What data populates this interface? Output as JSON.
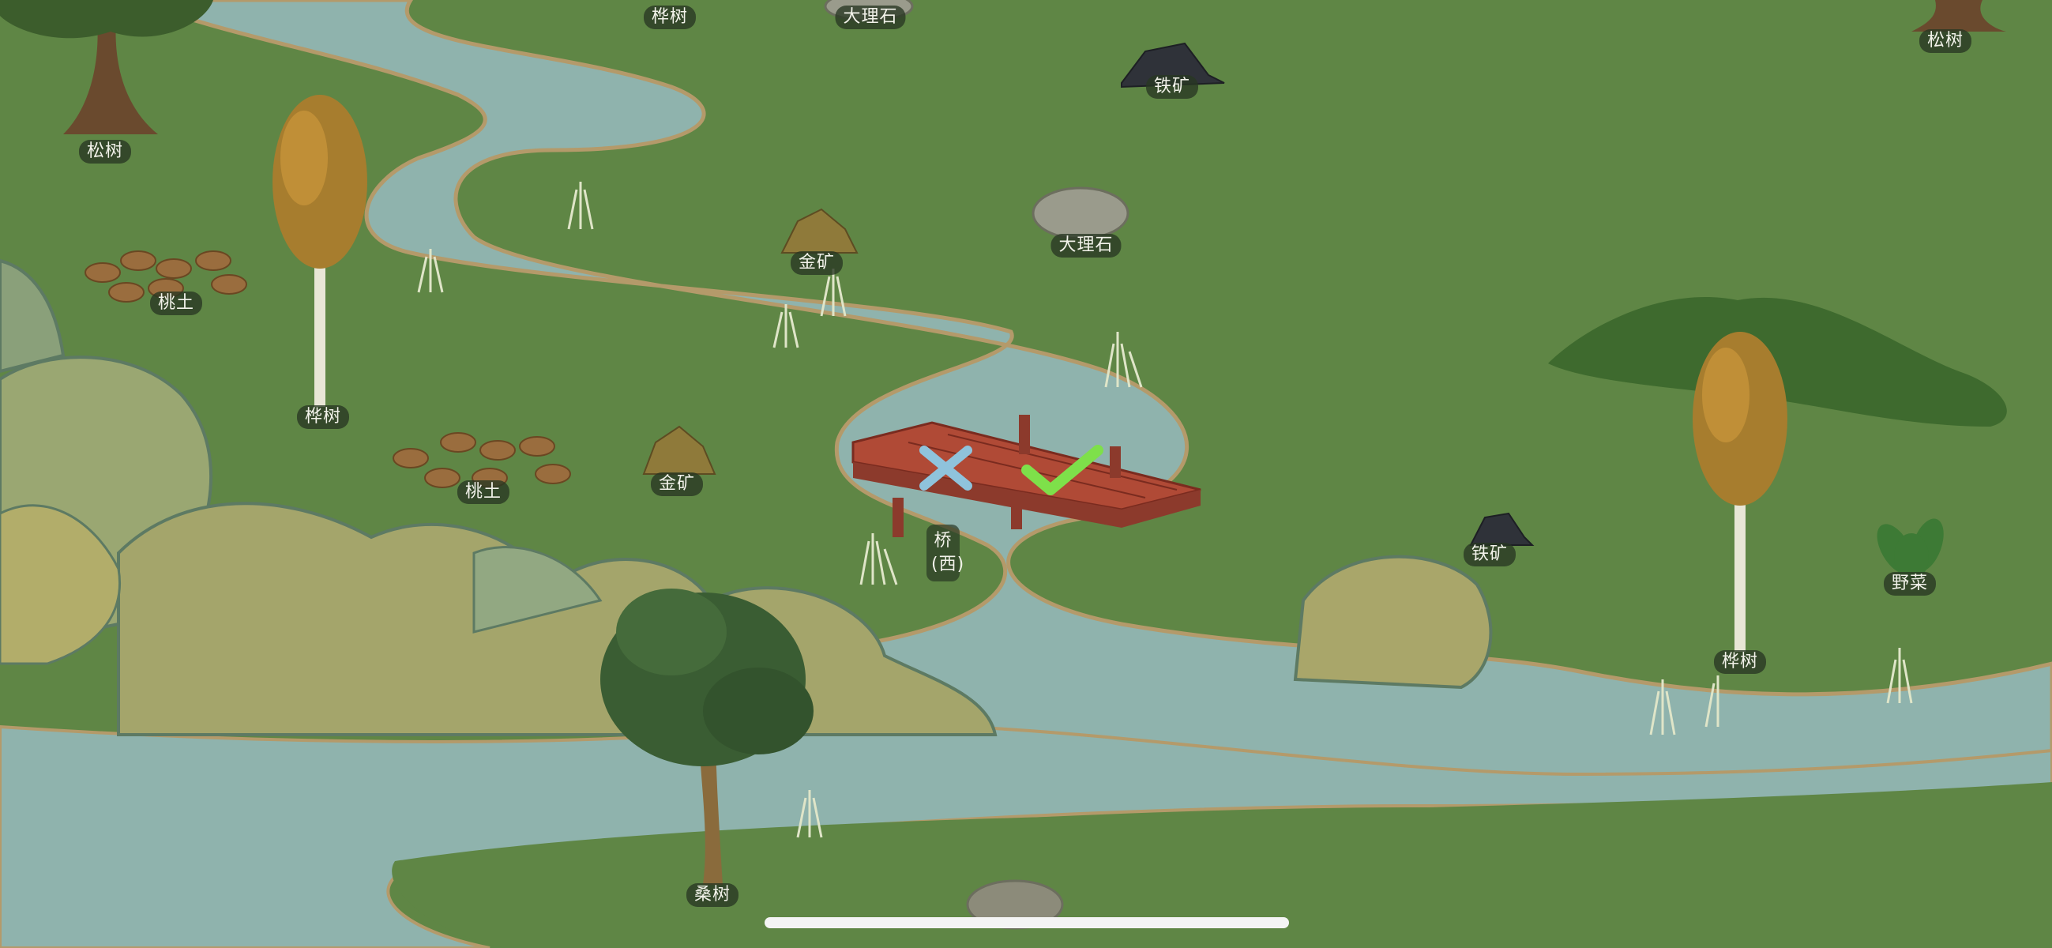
{
  "map": {
    "labels": {
      "birch_top": "桦树",
      "marble_top": "大理石",
      "pine_right": "松树",
      "iron_top": "铁矿",
      "pine_left": "松树",
      "marble_mid": "大理石",
      "gold_upper": "金矿",
      "peach_upper": "桃土",
      "birch_left": "桦树",
      "gold_lower": "金矿",
      "peach_lower": "桃土",
      "bridge": "桥(西)",
      "iron_right": "铁矿",
      "vegetable": "野菜",
      "birch_right": "桦树",
      "mulberry": "桑树"
    }
  },
  "placement": {
    "cancel_icon": "close-icon",
    "confirm_icon": "check-icon",
    "cancel_color": "#8fc3dc",
    "confirm_color": "#7ee04a"
  },
  "colors": {
    "grass": "#5f8645",
    "water": "#8fb3ad",
    "bank": "#b49a6a",
    "mountain": "#8aa07a"
  }
}
